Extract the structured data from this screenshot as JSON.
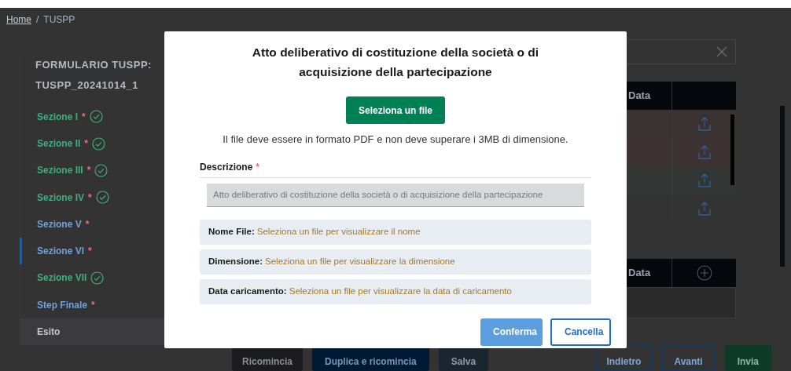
{
  "breadcrumb": {
    "items": [
      {
        "label": "Home",
        "link": true
      },
      {
        "label": "TUSPP",
        "link": false
      }
    ],
    "separator": "/"
  },
  "sidebar": {
    "title": "FORMULARIO TUSPP:",
    "code": "TUSPP_20241014_1",
    "items": [
      {
        "label": "Sezione I",
        "mark": "*",
        "completed": true,
        "selected": false,
        "kind": "section"
      },
      {
        "label": "Sezione II",
        "mark": "*",
        "completed": true,
        "selected": false,
        "kind": "section"
      },
      {
        "label": "Sezione III",
        "mark": "*",
        "completed": true,
        "selected": false,
        "kind": "section"
      },
      {
        "label": "Sezione IV",
        "mark": "*",
        "completed": true,
        "selected": false,
        "kind": "section"
      },
      {
        "label": "Sezione V",
        "mark": "*",
        "completed": false,
        "selected": false,
        "kind": "section"
      },
      {
        "label": "Sezione VI",
        "mark": "*",
        "completed": false,
        "selected": true,
        "kind": "section"
      },
      {
        "label": "Sezione VII",
        "completed": true,
        "selected": false,
        "kind": "section"
      },
      {
        "label": "Step Finale",
        "mark": "*",
        "completed": false,
        "selected": false,
        "kind": "section"
      },
      {
        "label": "Esito",
        "completed": false,
        "selected": false,
        "kind": "result"
      }
    ]
  },
  "documents_table": {
    "columns": [
      "Data"
    ],
    "rows": [
      {
        "color": "#3a3131"
      },
      {
        "color": "#3d3232"
      },
      {
        "color": "#323634"
      },
      {
        "color": "#333333"
      }
    ]
  },
  "attachments_table": {
    "columns": [
      "Data"
    ]
  },
  "actions": [
    {
      "label": "Ricomincia",
      "kind": "secondary"
    },
    {
      "label": "Duplica e ricomincia",
      "kind": "primary"
    },
    {
      "label": "Salva",
      "kind": "tertiary"
    },
    {
      "label": "Indietro",
      "kind": "outline"
    },
    {
      "label": "Avanti",
      "kind": "outline"
    },
    {
      "label": "Invia",
      "kind": "success"
    }
  ],
  "modal": {
    "title": "Atto deliberativo di costituzione della società o di acquisizione della partecipazione",
    "select_button": "Seleziona un file",
    "hint": "Il file deve essere in formato PDF e non deve superare i 3MB di dimensione.",
    "description": {
      "label": "Descrizione",
      "mark": "*",
      "value": "Atto deliberativo di costituzione della società o di acquisizione della partecipazione",
      "disabled": true
    },
    "info": [
      {
        "label": "Nome File:",
        "value": "Seleziona un file per visualizzare il nome"
      },
      {
        "label": "Dimensione:",
        "value": "Seleziona un file per visualizzare la dimensione"
      },
      {
        "label": "Data caricamento:",
        "value": "Seleziona un file per visualizzare la data di caricamento"
      }
    ],
    "buttons": [
      {
        "label": "Conferma",
        "kind": "primary"
      },
      {
        "label": "Cancella",
        "kind": "outline"
      }
    ]
  }
}
